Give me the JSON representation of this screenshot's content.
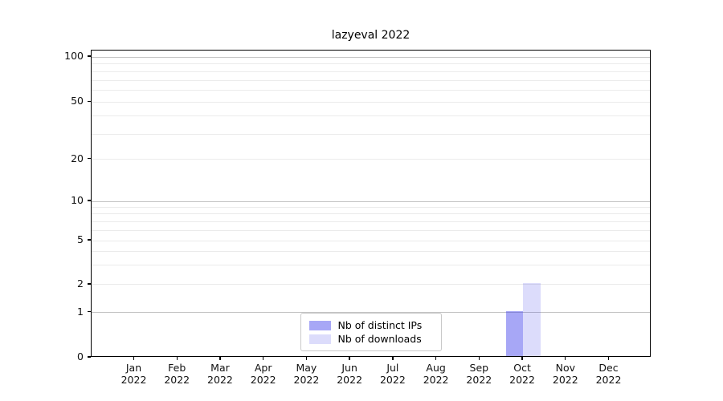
{
  "chart_data": {
    "type": "bar",
    "title": "lazyeval 2022",
    "categories": [
      {
        "line1": "Jan",
        "line2": "2022"
      },
      {
        "line1": "Feb",
        "line2": "2022"
      },
      {
        "line1": "Mar",
        "line2": "2022"
      },
      {
        "line1": "Apr",
        "line2": "2022"
      },
      {
        "line1": "May",
        "line2": "2022"
      },
      {
        "line1": "Jun",
        "line2": "2022"
      },
      {
        "line1": "Jul",
        "line2": "2022"
      },
      {
        "line1": "Aug",
        "line2": "2022"
      },
      {
        "line1": "Sep",
        "line2": "2022"
      },
      {
        "line1": "Oct",
        "line2": "2022"
      },
      {
        "line1": "Nov",
        "line2": "2022"
      },
      {
        "line1": "Dec",
        "line2": "2022"
      }
    ],
    "series": [
      {
        "name": "Nb of distinct IPs",
        "color": "rgba(60,60,235,0.45)",
        "values": [
          0,
          0,
          0,
          0,
          0,
          0,
          0,
          0,
          0,
          1,
          0,
          0
        ]
      },
      {
        "name": "Nb of downloads",
        "color": "rgba(60,60,235,0.18)",
        "values": [
          0,
          0,
          0,
          0,
          0,
          0,
          0,
          0,
          0,
          2,
          0,
          0
        ]
      }
    ],
    "xlabel": "",
    "ylabel": "",
    "y_axis": {
      "scale": "symlog",
      "range": [
        0,
        110
      ],
      "ticks": [
        {
          "v": 0,
          "label": "0",
          "f": 0.0,
          "major": false
        },
        {
          "v": 1,
          "label": "1",
          "f": 0.1475,
          "major": true
        },
        {
          "v": 2,
          "label": "2",
          "f": 0.2376,
          "major": false
        },
        {
          "v": 5,
          "label": "5",
          "f": 0.3812,
          "major": false
        },
        {
          "v": 10,
          "label": "10",
          "f": 0.5091,
          "major": true
        },
        {
          "v": 20,
          "label": "20",
          "f": 0.6462,
          "major": false
        },
        {
          "v": 50,
          "label": "50",
          "f": 0.8316,
          "major": false
        },
        {
          "v": 100,
          "label": "100",
          "f": 0.9791,
          "major": true
        }
      ],
      "minor_gridlines": [
        {
          "v": 3,
          "f": 0.3011
        },
        {
          "v": 4,
          "f": 0.3462
        },
        {
          "v": 6,
          "f": 0.4146
        },
        {
          "v": 7,
          "f": 0.4433
        },
        {
          "v": 8,
          "f": 0.4679
        },
        {
          "v": 9,
          "f": 0.4895
        },
        {
          "v": 30,
          "f": 0.7282
        },
        {
          "v": 40,
          "f": 0.7864
        },
        {
          "v": 60,
          "f": 0.8702
        },
        {
          "v": 70,
          "f": 0.9031
        },
        {
          "v": 80,
          "f": 0.9316
        },
        {
          "v": 90,
          "f": 0.9567
        }
      ]
    },
    "grid": true,
    "grid_major_color": "#c3c3c3",
    "grid_minor_color": "#ebebeb",
    "spine_color": "#000000",
    "legend_position": "lower center"
  }
}
